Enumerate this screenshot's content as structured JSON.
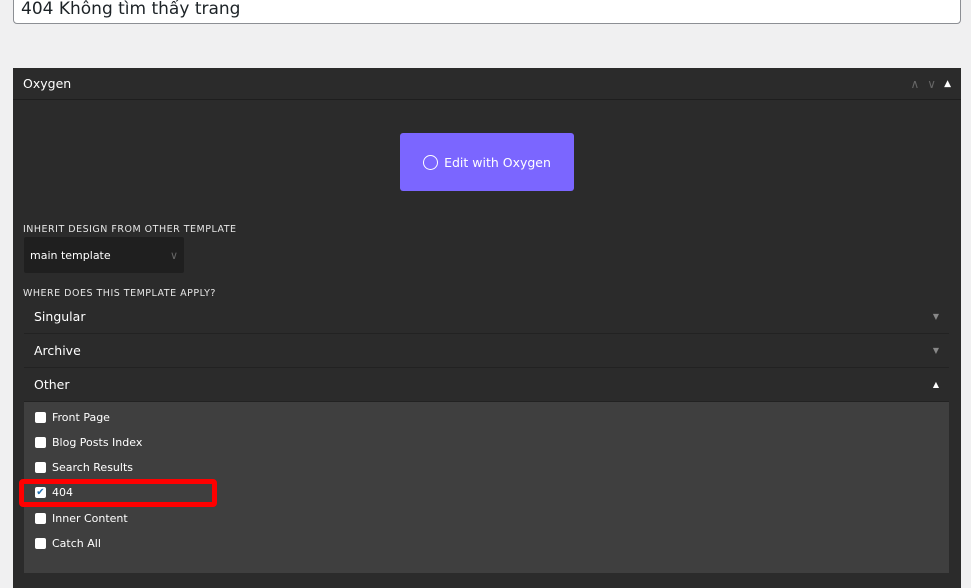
{
  "title_input": {
    "value": "404 Không tìm thấy trang"
  },
  "panel": {
    "title": "Oxygen",
    "controls": [
      "chevron-up",
      "chevron-down",
      "collapse-triangle"
    ]
  },
  "edit_button": {
    "label": "Edit with Oxygen",
    "color": "#7b66ff"
  },
  "inherit": {
    "label": "INHERIT DESIGN FROM OTHER TEMPLATE",
    "selected": "main template"
  },
  "apply": {
    "label": "WHERE DOES THIS TEMPLATE APPLY?",
    "sections": [
      {
        "label": "Singular",
        "expanded": false
      },
      {
        "label": "Archive",
        "expanded": false
      },
      {
        "label": "Other",
        "expanded": true
      }
    ],
    "other_options": [
      {
        "label": "Front Page",
        "checked": false
      },
      {
        "label": "Blog Posts Index",
        "checked": false
      },
      {
        "label": "Search Results",
        "checked": false
      },
      {
        "label": "404",
        "checked": true
      },
      {
        "label": "Inner Content",
        "checked": false
      },
      {
        "label": "Catch All",
        "checked": false
      }
    ]
  },
  "highlight_color": "#ff0000"
}
